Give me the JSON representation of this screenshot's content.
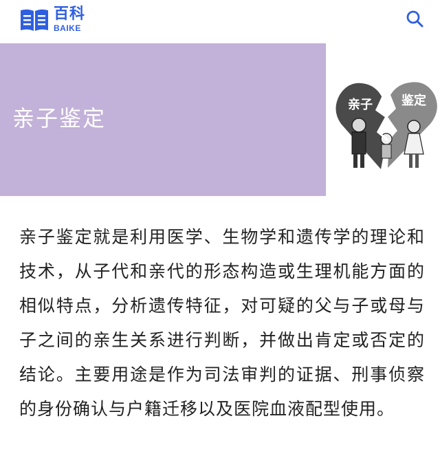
{
  "header": {
    "logo_cn": "百科",
    "logo_en": "BAIKE",
    "logo_icon": "book-icon",
    "search_icon": "search-icon"
  },
  "hero": {
    "title": "亲子鉴定",
    "image": {
      "icon": "broken-heart-illustration",
      "label_left": "亲子",
      "label_right": "鉴定"
    },
    "band_color": "#c2b1d9"
  },
  "article": {
    "text": "亲子鉴定就是利用医学、生物学和遗传学的理论和技术，从子代和亲代的形态构造或生理机能方面的相似特点，分析遗传特征，对可疑的父与子或母与子之间的亲生关系进行判断，并做出肯定或否定的结论。主要用途是作为司法审判的证据、刑事侦察的身份确认与户籍迁移以及医院血液配型使用。"
  },
  "colors": {
    "accent": "#2f5fe0"
  }
}
